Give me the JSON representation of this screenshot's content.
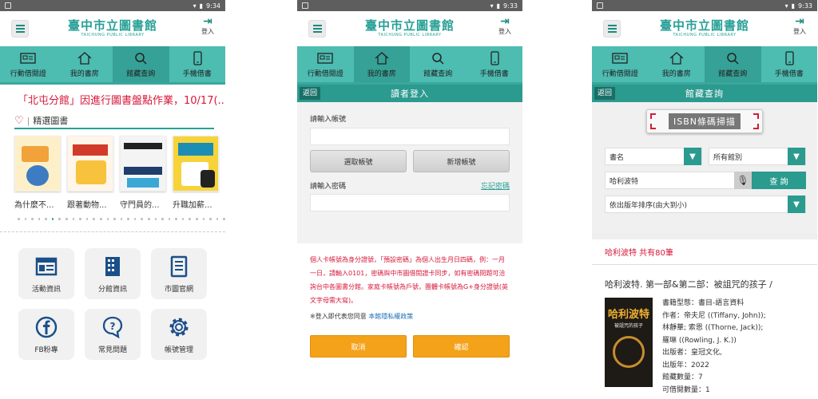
{
  "status": {
    "time1": "9:34",
    "time2": "9:33",
    "time3": "9:33"
  },
  "header": {
    "logo_zh": "臺中市立圖書館",
    "logo_en": "TAICHUNG PUBLIC LIBRARY",
    "login": "登入"
  },
  "tabs": [
    "行動借閱證",
    "我的書房",
    "館藏查詢",
    "手機借書"
  ],
  "home": {
    "marquee": "「北屯分館」因進行圖書盤點作業，10/17(...",
    "featured_title": "精選圖書",
    "books": [
      "為什麼不...",
      "跟著動物...",
      "守門員的...",
      "升職加薪..."
    ],
    "grid": [
      "活動資訊",
      "分館資訊",
      "市圖官網",
      "FB粉專",
      "常見問題",
      "帳號管理"
    ]
  },
  "login_page": {
    "back": "返回",
    "title": "讀者登入",
    "account_label": "請輸入帳號",
    "choose_account": "選取帳號",
    "new_account": "新增帳號",
    "password_label": "請輸入密碼",
    "forgot": "忘記密碼",
    "notice": "個人卡帳號為身分證號，「預設密碼」為個人出生月日四碼，例：一月一日，請輸入0101，密碼與中市圖借閱證卡同步，如有密碼問題可洽詢台中各圖書分館。家庭卡帳號為戶號，團體卡帳號為G+身分證號(英文字母需大寫)。",
    "privacy_prefix": "※登入即代表您同意",
    "privacy_link": "本館隱私權政策",
    "cancel": "取消",
    "confirm": "確認"
  },
  "search": {
    "back": "返回",
    "title": "館藏查詢",
    "isbn": "ISBN條碼掃描",
    "field": "書名",
    "branch": "所有館別",
    "query": "哈利波特",
    "search_btn": "查 詢",
    "sort": "依出版年排序(由大到小)",
    "result_count": "哈利波特 共有80筆",
    "result_title": "哈利波特. 第一部&第二部：被詛咒的孩子 /",
    "details": [
      "書籍型態：書目-語言資料",
      "作者：帝夫尼 ((Tiffany, John));",
      "林靜華; 索恩 ((Thorne, Jack));",
      "羅琳 ((Rowling, J. K.))",
      "出版者：皇冠文化,",
      "出版年：2022",
      "館藏數量：7",
      "可借閱數量：1"
    ],
    "cover_title": "哈利波特",
    "cover_sub": "被詛咒的孩子"
  },
  "colors": {
    "teal": "#4dbcb1",
    "teal_dark": "#2b9a8f",
    "red": "#d6183a",
    "orange": "#f4a21a"
  }
}
